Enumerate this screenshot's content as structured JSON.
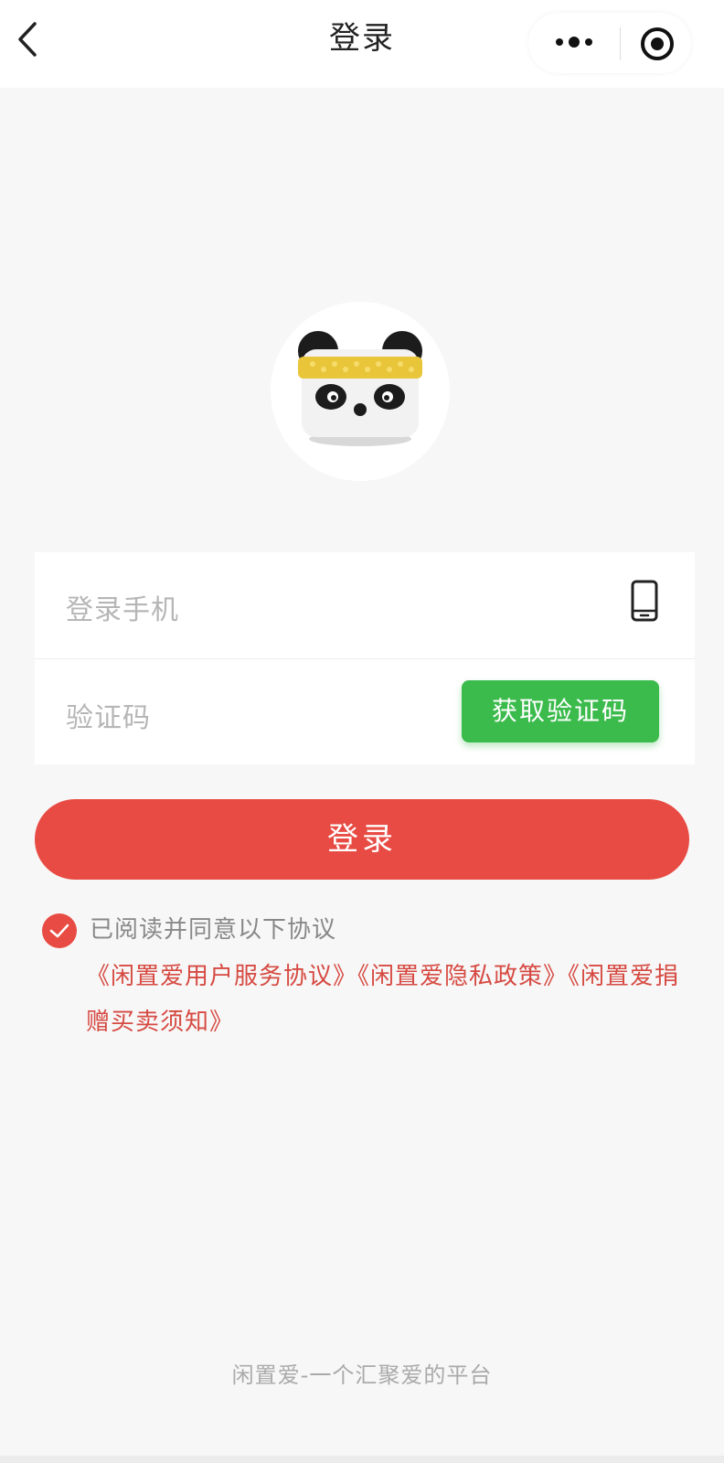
{
  "header": {
    "title": "登录",
    "back_icon": "chevron-left-icon",
    "more_icon": "more-dots-icon",
    "target_icon": "close-target-icon"
  },
  "logo": {
    "icon": "panda-logo-icon"
  },
  "form": {
    "phone_placeholder": "登录手机",
    "phone_icon": "phone-icon",
    "code_placeholder": "验证码",
    "get_code_label": "获取验证码"
  },
  "login_button": "登录",
  "agreement": {
    "checked": true,
    "text": "已阅读并同意以下协议",
    "link_user_service": "《闲置爱用户服务协议》",
    "link_privacy": "《闲置爱隐私政策》",
    "link_donation": "《闲置爱捐赠买卖须知》"
  },
  "footer": "闲置爱-一个汇聚爱的平台",
  "colors": {
    "primary_red": "#e84b43",
    "link_red": "#d64a42",
    "green": "#3cbb4d",
    "background": "#f7f7f7"
  }
}
